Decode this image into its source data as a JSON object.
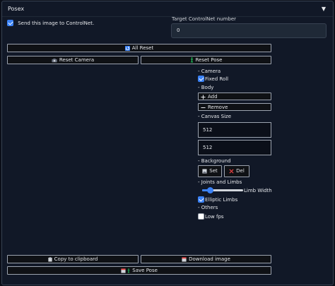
{
  "panel": {
    "title": "Posex",
    "collapse_glyph": "▼"
  },
  "send_to_controlnet": {
    "label": "Send this image to ControlNet.",
    "checked": true
  },
  "target_controlnet": {
    "label": "Target ControlNet number",
    "value": "0"
  },
  "buttons": {
    "all_reset": "All Reset",
    "reset_camera": "Reset Camera",
    "reset_pose": "Reset Pose",
    "copy_clipboard": "Copy to clipboard",
    "download_image": "Download image",
    "save_pose": "Save Pose"
  },
  "camera": {
    "heading": "- Camera",
    "fixed_roll": {
      "label": "Fixed Roll",
      "checked": true
    }
  },
  "body": {
    "heading": "- Body",
    "add": "Add",
    "remove": "Remove"
  },
  "canvas_size": {
    "heading": "- Canvas Size",
    "width": "512",
    "height": "512"
  },
  "background": {
    "heading": "- Background",
    "set": "Set",
    "del": "Del"
  },
  "joints_limbs": {
    "heading": "- Joints and Limbs",
    "limb_width_label": "Limb Width",
    "limb_width_fraction": 0.2,
    "elliptic_limbs": {
      "label": "Elliptic Limbs",
      "checked": true
    }
  },
  "others": {
    "heading": "- Others",
    "low_fps": {
      "label": "Low fps",
      "checked": false
    }
  },
  "colors": {
    "accent": "#3b82f6",
    "background": "#0b0f19",
    "panel": "#111827",
    "del_icon": "#ef4444",
    "pose_icon": "#22c55e"
  },
  "icons": [
    "reset-icon",
    "camera-icon",
    "figure-icon",
    "plus-icon",
    "minus-icon",
    "image-icon",
    "cross-icon",
    "clipboard-icon",
    "download-icon",
    "save-icon"
  ]
}
